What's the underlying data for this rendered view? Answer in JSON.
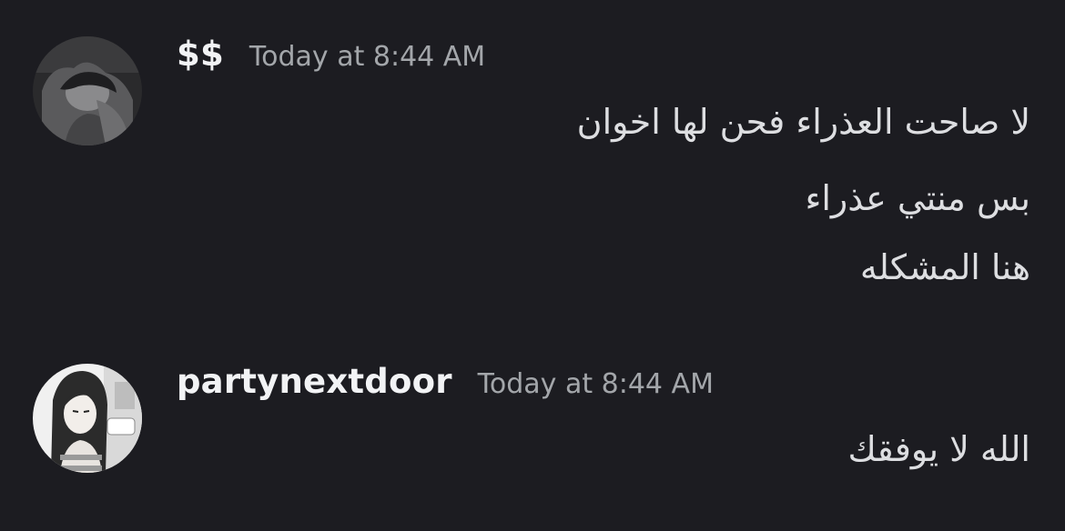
{
  "messages": [
    {
      "author": "$$",
      "timestamp": "Today at 8:44 AM",
      "avatar_icon": "user-avatar-photo",
      "lines": [
        "لا صاحت العذراء فحن لها اخوان",
        "بس منتي عذراء",
        "هنا المشكله"
      ]
    },
    {
      "author": "partynextdoor",
      "timestamp": "Today at 8:44 AM",
      "avatar_icon": "anime-avatar-icon",
      "lines": [
        "الله لا يوفقك"
      ]
    }
  ],
  "colors": {
    "background": "#1c1c21",
    "username": "#f2f3f5",
    "timestamp": "#a3a6aa",
    "message_text": "#dddee1"
  }
}
